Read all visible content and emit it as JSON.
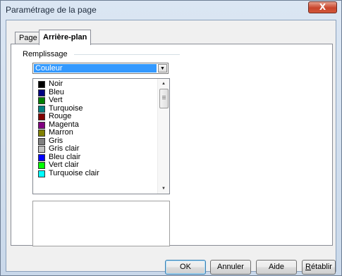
{
  "window": {
    "title": "Paramétrage de la page",
    "close_glyph": "X"
  },
  "tabs": [
    {
      "label": "Page"
    },
    {
      "label": "Arrière-plan"
    }
  ],
  "fill": {
    "group_label": "Remplissage",
    "type_selected": "Couleur",
    "colors": [
      {
        "name": "Noir",
        "hex": "#000000"
      },
      {
        "name": "Bleu",
        "hex": "#000080"
      },
      {
        "name": "Vert",
        "hex": "#008000"
      },
      {
        "name": "Turquoise",
        "hex": "#008080"
      },
      {
        "name": "Rouge",
        "hex": "#800000"
      },
      {
        "name": "Magenta",
        "hex": "#800080"
      },
      {
        "name": "Marron",
        "hex": "#808000"
      },
      {
        "name": "Gris",
        "hex": "#808080"
      },
      {
        "name": "Gris clair",
        "hex": "#c0c0c0"
      },
      {
        "name": "Bleu clair",
        "hex": "#0000ff"
      },
      {
        "name": "Vert clair",
        "hex": "#00ff00"
      },
      {
        "name": "Turquoise clair",
        "hex": "#00ffff"
      }
    ]
  },
  "buttons": {
    "ok": "OK",
    "cancel": "Annuler",
    "help": "Aide",
    "reset_first": "R",
    "reset_rest": "établir"
  }
}
